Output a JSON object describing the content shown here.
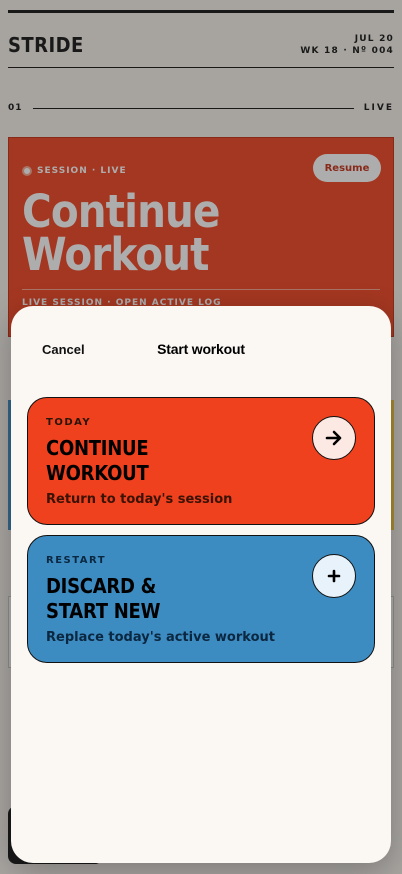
{
  "app": {
    "brand": "STRIDE",
    "date": "JUL 20",
    "week": "WK 18 · Nº 004"
  },
  "section": {
    "number": "01",
    "status": "LIVE"
  },
  "hero": {
    "tag": "SESSION · LIVE",
    "resume_label": "Resume",
    "title_line1": "Continue",
    "title_line2": "Workout",
    "subtitle": "LIVE SESSION · OPEN ACTIVE LOG"
  },
  "sheet": {
    "cancel_label": "Cancel",
    "title": "Start workout",
    "options": [
      {
        "eyebrow": "TODAY",
        "title_line1": "CONTINUE",
        "title_line2": "WORKOUT",
        "description": "Return to today's session",
        "icon": "arrow-right-icon",
        "color": "#f0411e"
      },
      {
        "eyebrow": "RESTART",
        "title_line1": "DISCARD &",
        "title_line2": "START NEW",
        "description": "Replace today's active workout",
        "icon": "plus-icon",
        "color": "#3c8cc2"
      }
    ]
  }
}
